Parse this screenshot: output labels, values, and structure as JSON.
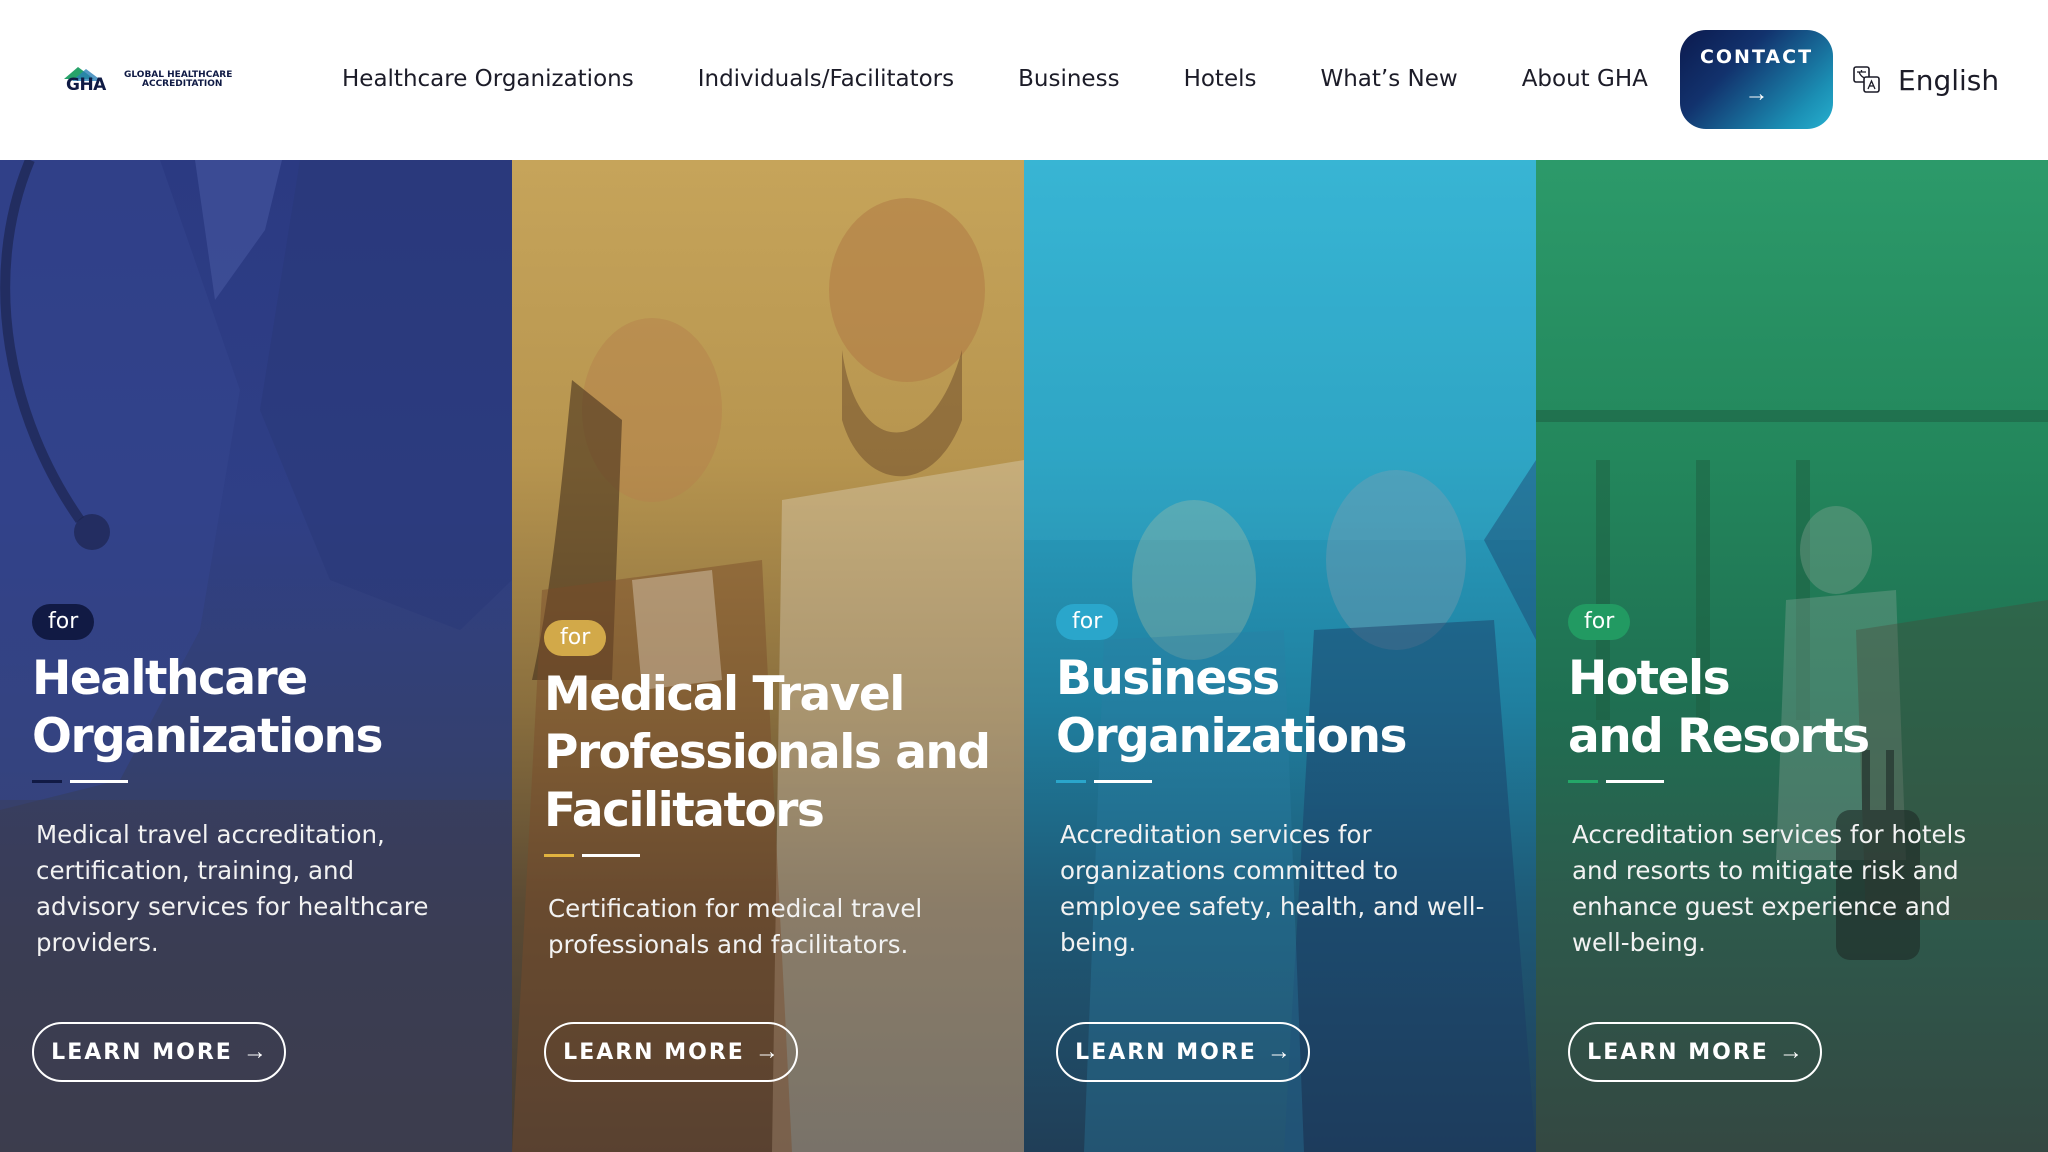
{
  "header": {
    "logo": {
      "mark": "GHA",
      "line1": "GLOBAL HEALTHCARE",
      "line2": "ACCREDITATION"
    },
    "nav": [
      "Healthcare Organizations",
      "Individuals/Facilitators",
      "Business",
      "Hotels",
      "What’s New",
      "About GHA"
    ],
    "contact": {
      "label": "CONTACT",
      "arrow": "→"
    },
    "language": {
      "label": "English",
      "icon": "translate-icon"
    }
  },
  "panels": [
    {
      "badge": "for",
      "badge_color": "#111a44",
      "accent": "#111a44",
      "title_lines": [
        "Healthcare",
        "Organizations"
      ],
      "description_lines": [
        "Medical travel accreditation,",
        "certification, training, and",
        "advisory services for healthcare",
        "providers."
      ],
      "button": "LEARN MORE",
      "arrow": "→"
    },
    {
      "badge": "for",
      "badge_color": "#d2a949",
      "accent": "#e1b33f",
      "title_lines": [
        "Medical Travel",
        "Professionals and",
        "Facilitators"
      ],
      "description_lines": [
        "Certification for medical travel",
        "professionals and facilitators."
      ],
      "button": "LEARN MORE",
      "arrow": "→"
    },
    {
      "badge": "for",
      "badge_color": "#2aa6cb",
      "accent": "#2aa6cb",
      "title_lines": [
        "Business",
        "Organizations"
      ],
      "description_lines": [
        "Accreditation services for",
        "organizations committed to",
        "employee safety, health, and well-",
        "being."
      ],
      "button": "LEARN MORE",
      "arrow": "→"
    },
    {
      "badge": "for",
      "badge_color": "#229a62",
      "accent": "#24a768",
      "title_lines": [
        "Hotels",
        "and Resorts"
      ],
      "description_lines": [
        "Accreditation services for hotels",
        "and resorts to mitigate risk and",
        "enhance guest experience and",
        "well-being."
      ],
      "button": "LEARN MORE",
      "arrow": "→"
    }
  ]
}
